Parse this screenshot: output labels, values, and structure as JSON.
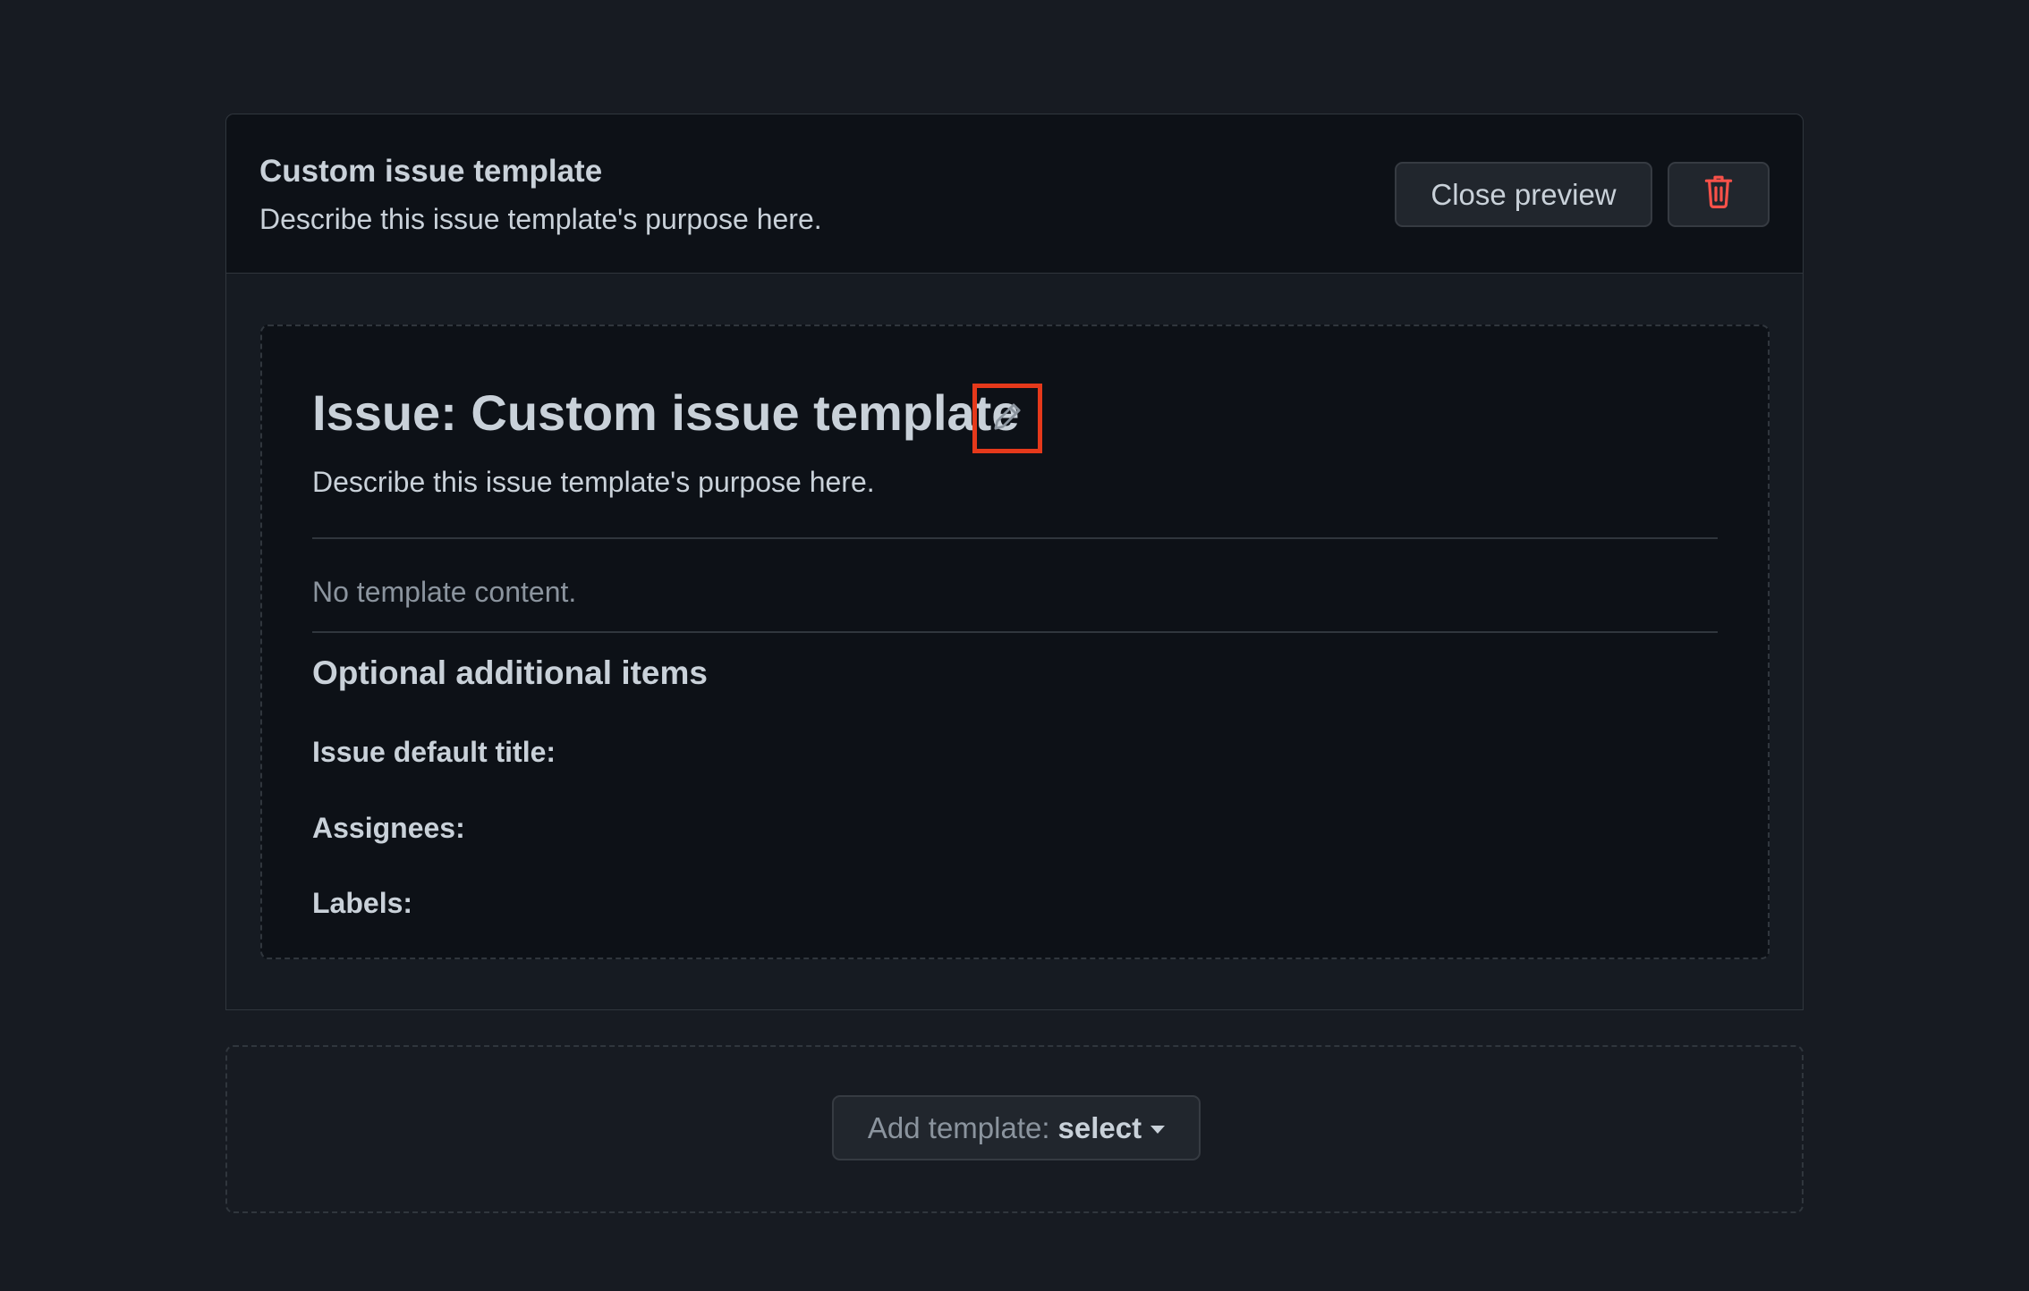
{
  "template": {
    "title": "Custom issue template",
    "description": "Describe this issue template's purpose here.",
    "close_preview_label": "Close preview",
    "delete_icon": "trash-icon"
  },
  "preview": {
    "title": "Issue: Custom issue template",
    "edit_icon": "pencil-icon",
    "description": "Describe this issue template's purpose here.",
    "empty_content": "No template content.",
    "optional_heading": "Optional additional items",
    "fields": {
      "default_title": "Issue default title:",
      "assignees": "Assignees:",
      "labels": "Labels:"
    }
  },
  "add_template": {
    "prefix": "Add template:",
    "value": "select"
  },
  "colors": {
    "background": "#171b22",
    "panel": "#0d1117",
    "danger": "#f85149",
    "highlight": "#e5391b"
  }
}
